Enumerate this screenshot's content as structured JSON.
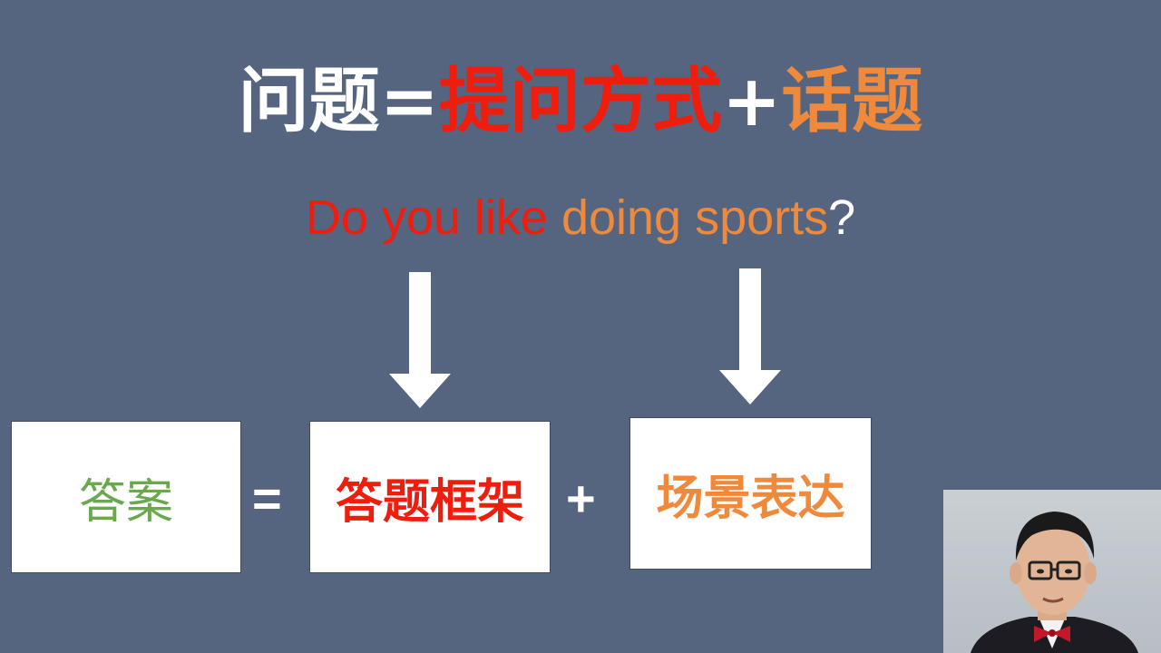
{
  "colors": {
    "background": "#55647f",
    "white": "#ffffff",
    "red": "#ee1d0e",
    "orange": "#ef8a3c",
    "green": "#6aa84f"
  },
  "title": {
    "part1": "问题=",
    "part2": "提问方式",
    "part3": "+",
    "part4": "话题"
  },
  "sentence": {
    "part_red": "Do you like ",
    "part_orange": "doing sports",
    "part_end": "?"
  },
  "equation": {
    "box1": "答案",
    "equals": "=",
    "box2": "答题框架",
    "plus": "+",
    "box3": "场景表达"
  },
  "icons": [
    "down-arrow-icon",
    "down-arrow-icon"
  ]
}
